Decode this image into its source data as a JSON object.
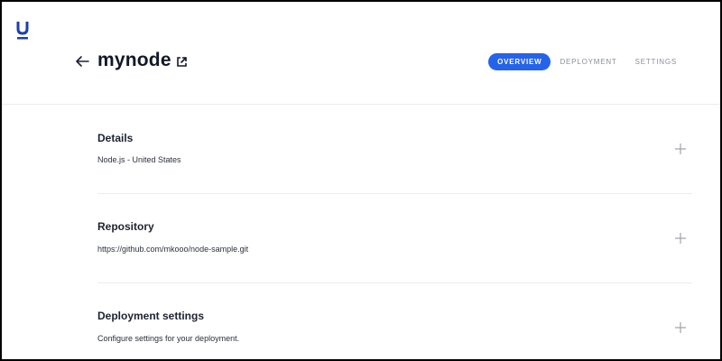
{
  "app": {
    "logo_letter": "U",
    "title": "mynode"
  },
  "icons": {
    "back": "arrow-left-icon",
    "external": "external-link-icon",
    "expand": "plus-icon"
  },
  "colors": {
    "accent": "#2563eb",
    "text": "#1c2330",
    "muted": "#8a8f98",
    "divider": "#ececf0"
  },
  "tabs": [
    {
      "label": "OVERVIEW",
      "active": true
    },
    {
      "label": "DEPLOYMENT",
      "active": false
    },
    {
      "label": "SETTINGS",
      "active": false
    }
  ],
  "sections": [
    {
      "title": "Details",
      "subtitle": "Node.js - United States"
    },
    {
      "title": "Repository",
      "subtitle": "https://github.com/mkooo/node-sample.git"
    },
    {
      "title": "Deployment settings",
      "subtitle": "Configure settings for your deployment."
    }
  ]
}
